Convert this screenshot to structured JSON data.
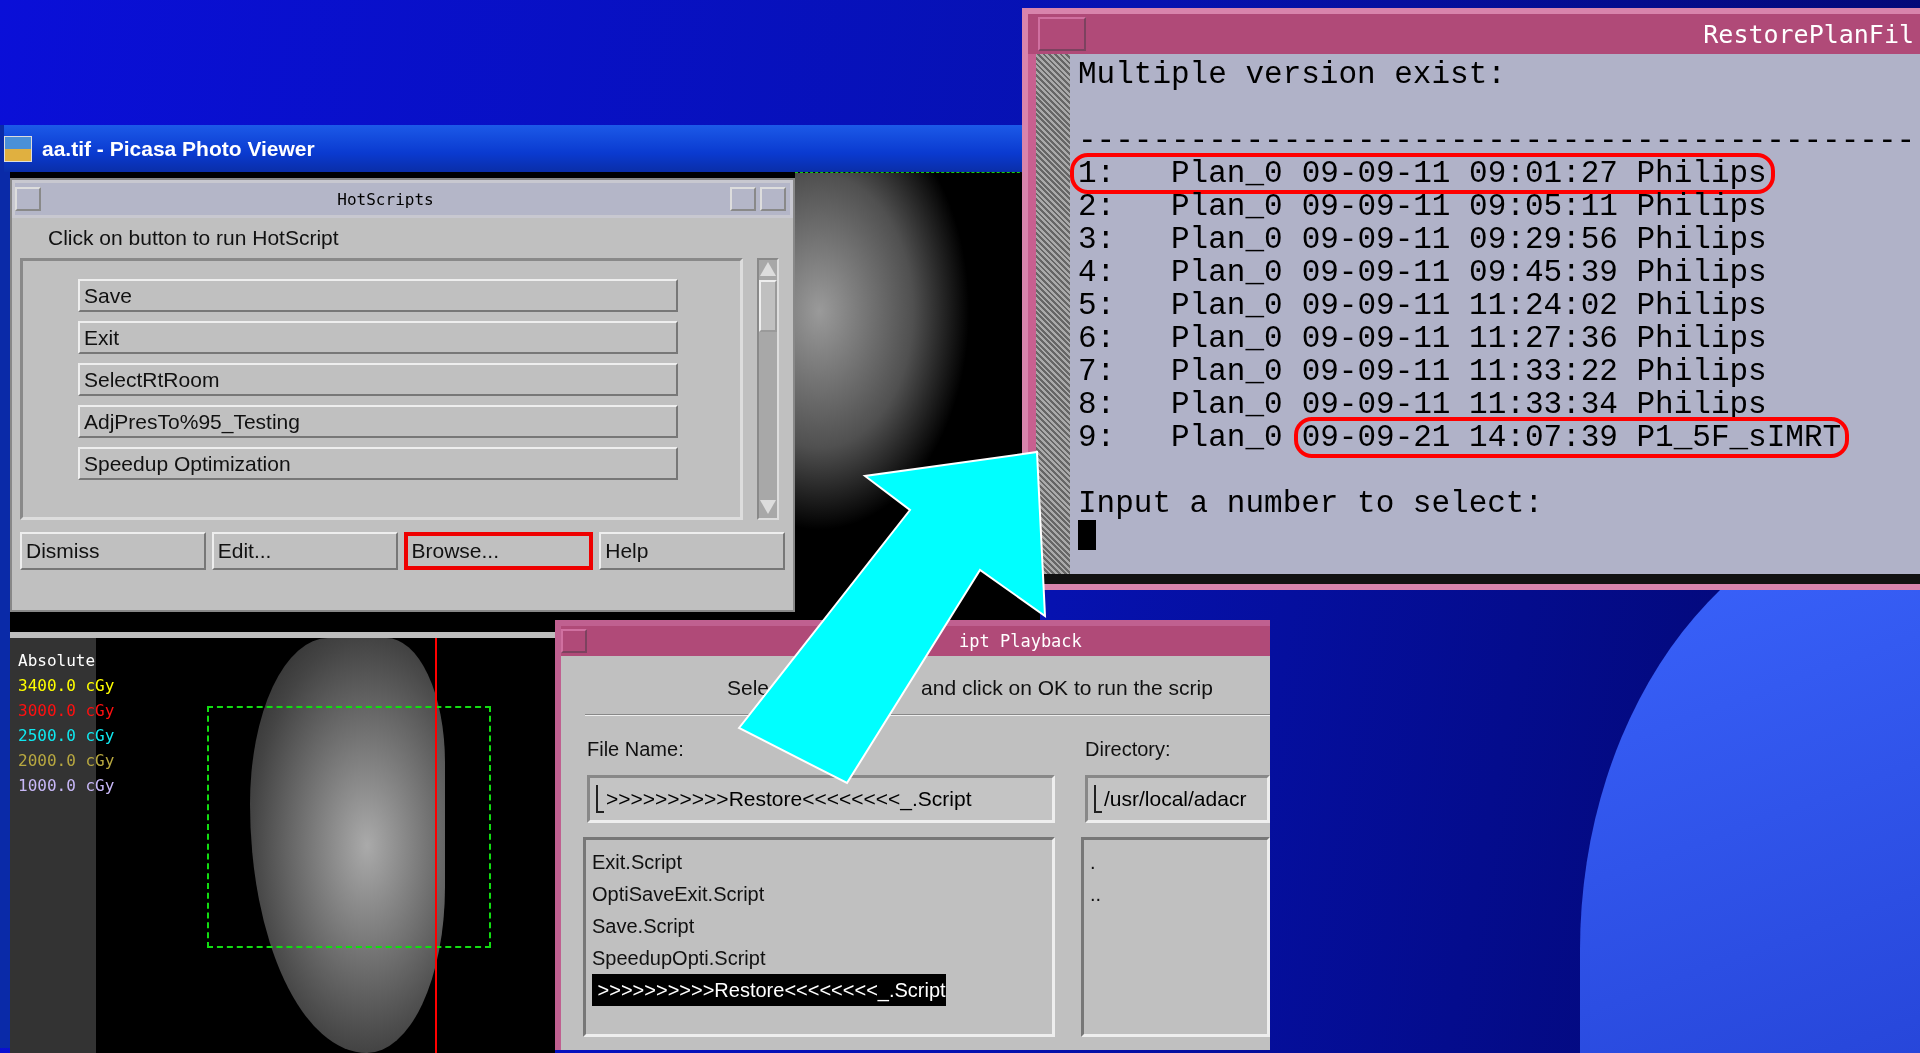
{
  "picasa_window": {
    "title": "aa.tif - Picasa Photo Viewer"
  },
  "hotscripts": {
    "title": "HotScripts",
    "prompt": "Click on button to run HotScript",
    "scripts": [
      "Save",
      "Exit",
      "SelectRtRoom",
      "AdjPresTo%95_Testing",
      "Speedup Optimization"
    ],
    "buttons": [
      {
        "label": "Dismiss",
        "highlighted": false
      },
      {
        "label": "Edit...",
        "highlighted": false
      },
      {
        "label": "Browse...",
        "highlighted": true
      },
      {
        "label": "Help",
        "highlighted": false
      }
    ]
  },
  "dose_view": {
    "mode": "Absolute",
    "isodose_lines": [
      {
        "label": "3400.0 cGy",
        "color": "#ffff00"
      },
      {
        "label": "3000.0 cGy",
        "color": "#ff1010"
      },
      {
        "label": "2500.0 cGy",
        "color": "#10e8f0"
      },
      {
        "label": "2000.0 cGy",
        "color": "#b8a840"
      },
      {
        "label": "1000.0 cGy",
        "color": "#c8b8f8"
      }
    ]
  },
  "script_playback": {
    "title": "ipt Playback",
    "prompt_start": "Sele",
    "prompt_end": "and click on OK to run the scrip",
    "file_name_label": "File Name:",
    "file_name_value": ">>>>>>>>>>Restore<<<<<<<<_.Script",
    "directory_label": "Directory:",
    "directory_value": "/usr/local/adacr",
    "files": [
      {
        "name": "Exit.Script",
        "selected": false
      },
      {
        "name": "OptiSaveExit.Script",
        "selected": false
      },
      {
        "name": "Save.Script",
        "selected": false
      },
      {
        "name": "SpeedupOpti.Script",
        "selected": false
      },
      {
        "name": " >>>>>>>>>>Restore<<<<<<<<_.Script",
        "selected": true
      }
    ],
    "directories": [
      ".",
      ".."
    ]
  },
  "restore_plan_window": {
    "title": "RestorePlanFil",
    "heading": "Multiple version exist:",
    "separator": "---------------------------------------------",
    "rows": [
      {
        "lead": "1:   Plan_0",
        "detail": "09-09-11 09:01:27 Philips",
        "lead_circled": true,
        "detail_circled": true
      },
      {
        "lead": "2:   Plan_0",
        "detail": "09-09-11 09:05:11 Philips",
        "lead_circled": false,
        "detail_circled": false
      },
      {
        "lead": "3:   Plan_0",
        "detail": "09-09-11 09:29:56 Philips",
        "lead_circled": false,
        "detail_circled": false
      },
      {
        "lead": "4:   Plan_0",
        "detail": "09-09-11 09:45:39 Philips",
        "lead_circled": false,
        "detail_circled": false
      },
      {
        "lead": "5:   Plan_0",
        "detail": "09-09-11 11:24:02 Philips",
        "lead_circled": false,
        "detail_circled": false
      },
      {
        "lead": "6:   Plan_0",
        "detail": "09-09-11 11:27:36 Philips",
        "lead_circled": false,
        "detail_circled": false
      },
      {
        "lead": "7:   Plan_0",
        "detail": "09-09-11 11:33:22 Philips",
        "lead_circled": false,
        "detail_circled": false
      },
      {
        "lead": "8:   Plan_0",
        "detail": "09-09-11 11:33:34 Philips",
        "lead_circled": false,
        "detail_circled": false
      },
      {
        "lead": "9:   Plan_0",
        "detail": "09-09-21 14:07:39 P1_5F_sIMRT",
        "lead_circled": false,
        "detail_circled": true
      }
    ],
    "input_prompt": "Input a number to select:"
  }
}
